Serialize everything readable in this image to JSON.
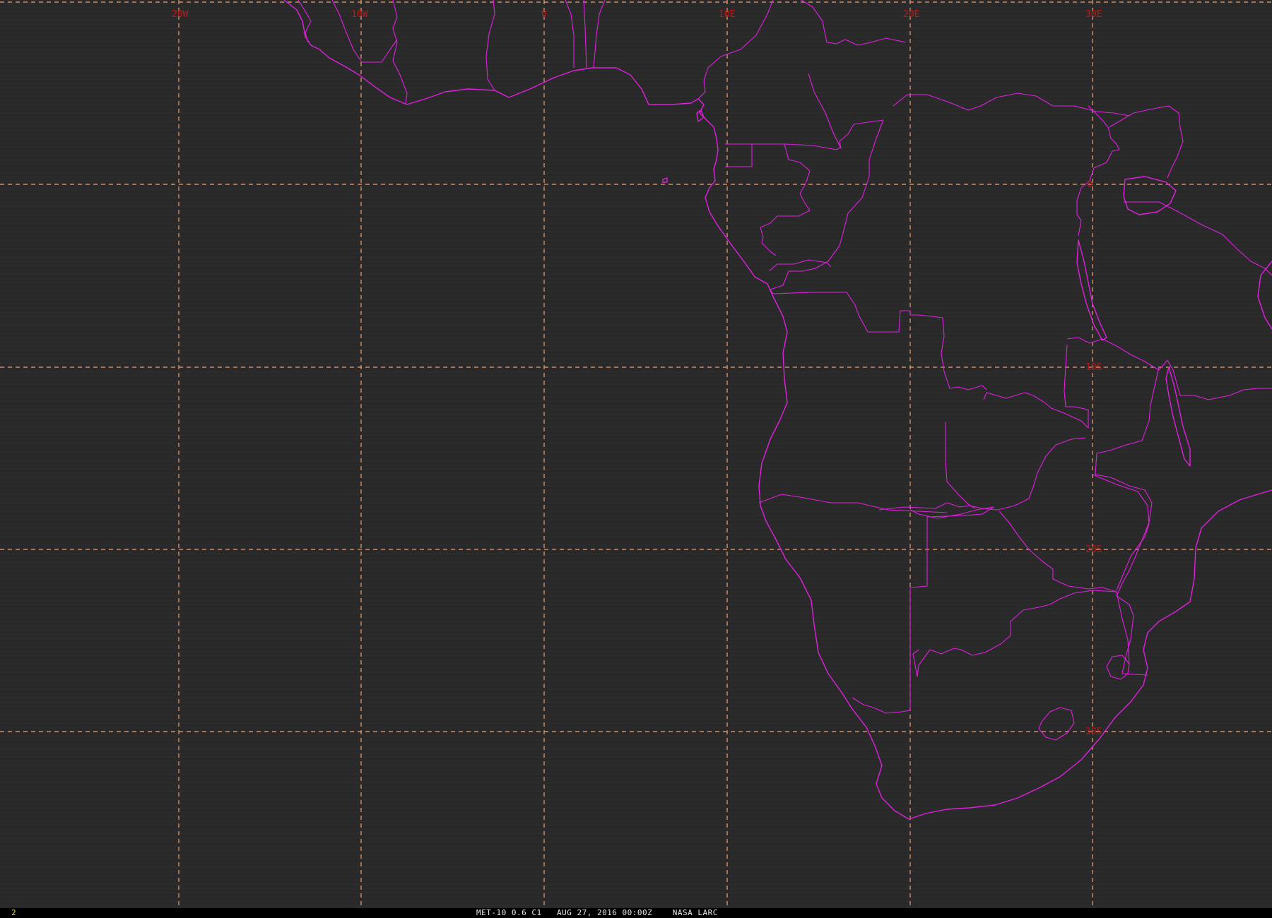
{
  "map": {
    "grid_labels": {
      "longitude": [
        "20W",
        "10W",
        "0",
        "10E",
        "20E",
        "30E"
      ],
      "latitude": [
        "0",
        "10S",
        "20S",
        "30S"
      ]
    },
    "colors": {
      "background": "#2a2a2a",
      "coastline": "#e020e0",
      "gridline": "#f0a070",
      "grid_label": "#c01818"
    }
  },
  "status_bar": {
    "frame_number": "2",
    "caption": "MET-10 0.6 C1   AUG 27, 2016 00:00Z    NASA LARC"
  }
}
